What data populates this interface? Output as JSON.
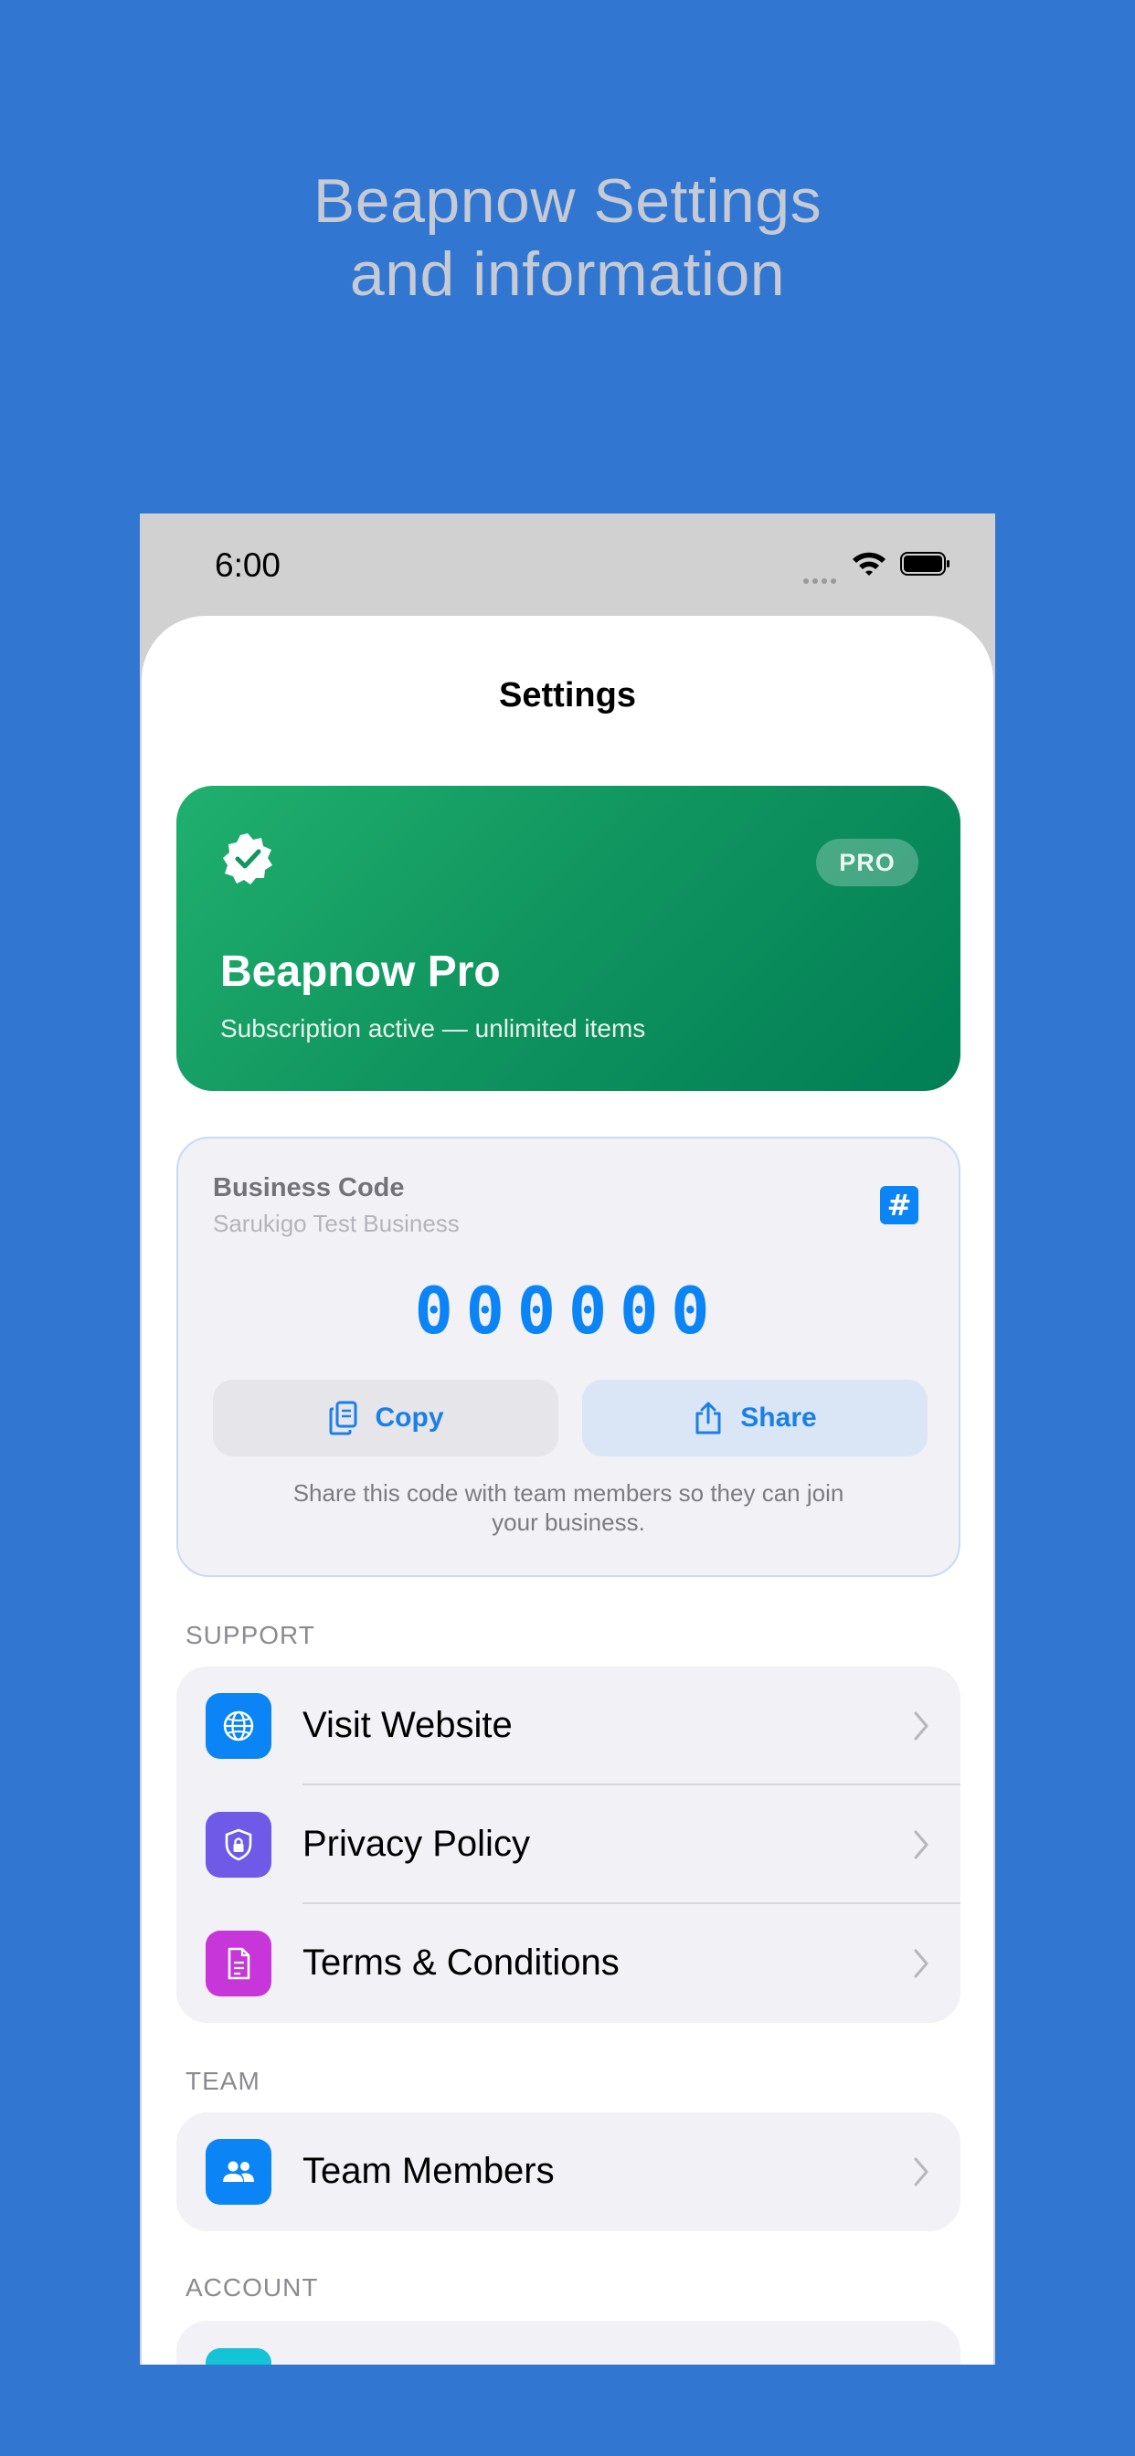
{
  "promo": {
    "line1": "Beapnow Settings",
    "line2": "and information"
  },
  "status_bar": {
    "time": "6:00"
  },
  "header": {
    "title": "Settings"
  },
  "pro_card": {
    "pill": "PRO",
    "title": "Beapnow Pro",
    "subtitle": "Subscription active — unlimited items"
  },
  "business_code": {
    "label": "Business Code",
    "business_name": "Sarukigo Test Business",
    "code": "000000",
    "copy_label": "Copy",
    "share_label": "Share",
    "note_line1": "Share this code with team members so they can join",
    "note_line2": "your business."
  },
  "support": {
    "header": "SUPPORT",
    "items": [
      {
        "label": "Visit Website",
        "icon": "globe-icon",
        "color": "#0b84f5"
      },
      {
        "label": "Privacy Policy",
        "icon": "shield-lock-icon",
        "color": "#6e5ae6"
      },
      {
        "label": "Terms & Conditions",
        "icon": "document-icon",
        "color": "#c636d9"
      }
    ]
  },
  "team": {
    "header": "TEAM",
    "items": [
      {
        "label": "Team Members",
        "icon": "people-icon",
        "color": "#0b84f5"
      }
    ]
  },
  "account": {
    "header": "ACCOUNT",
    "first_icon_color": "#14c3d6"
  },
  "colors": {
    "background": "#3176d0",
    "accent": "#0b84f5",
    "pro_green": "#119660"
  }
}
